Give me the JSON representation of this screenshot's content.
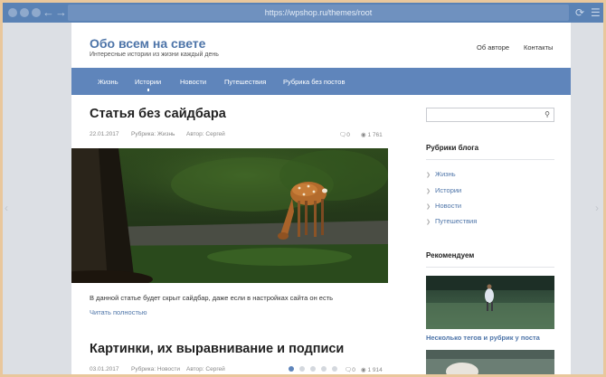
{
  "browser": {
    "url": "https://wpshop.ru/themes/root"
  },
  "site": {
    "title": "Обо всем на свете",
    "tagline": "Интересные истории из жизни каждый день",
    "top_links": [
      "Об авторе",
      "Контакты"
    ]
  },
  "menu": {
    "items": [
      "Жизнь",
      "Истории",
      "Новости",
      "Путешествия",
      "Рубрика без постов"
    ],
    "active_index": 1
  },
  "post1": {
    "title": "Статья без сайдбара",
    "date": "22.01.2017",
    "category": "Рубрика: Жизнь",
    "author": "Автор: Сергей",
    "comments": "0",
    "views": "1 761",
    "excerpt": "В данной статье будет скрыт сайдбар, даже если в настройках сайта он есть",
    "read_more": "Читать полностью"
  },
  "post2": {
    "title": "Картинки, их выравнивание и подписи",
    "date": "03.01.2017",
    "category": "Рубрика: Новости",
    "author": "Автор: Сергей",
    "comments": "0",
    "views": "1 914"
  },
  "sidebar": {
    "categories_title": "Рубрики блога",
    "categories": [
      "Жизнь",
      "Истории",
      "Новости",
      "Путешествия"
    ],
    "recommend_title": "Рекомендуем",
    "recommend_post_title": "Несколько тегов и рубрик у поста"
  },
  "colors": {
    "chrome": "#5a82b5",
    "menu": "#5f85bb",
    "accent": "#4d74a8"
  },
  "icons": {
    "comment": "speech-bubble-icon",
    "views": "eye-icon",
    "search": "magnifier-icon"
  }
}
